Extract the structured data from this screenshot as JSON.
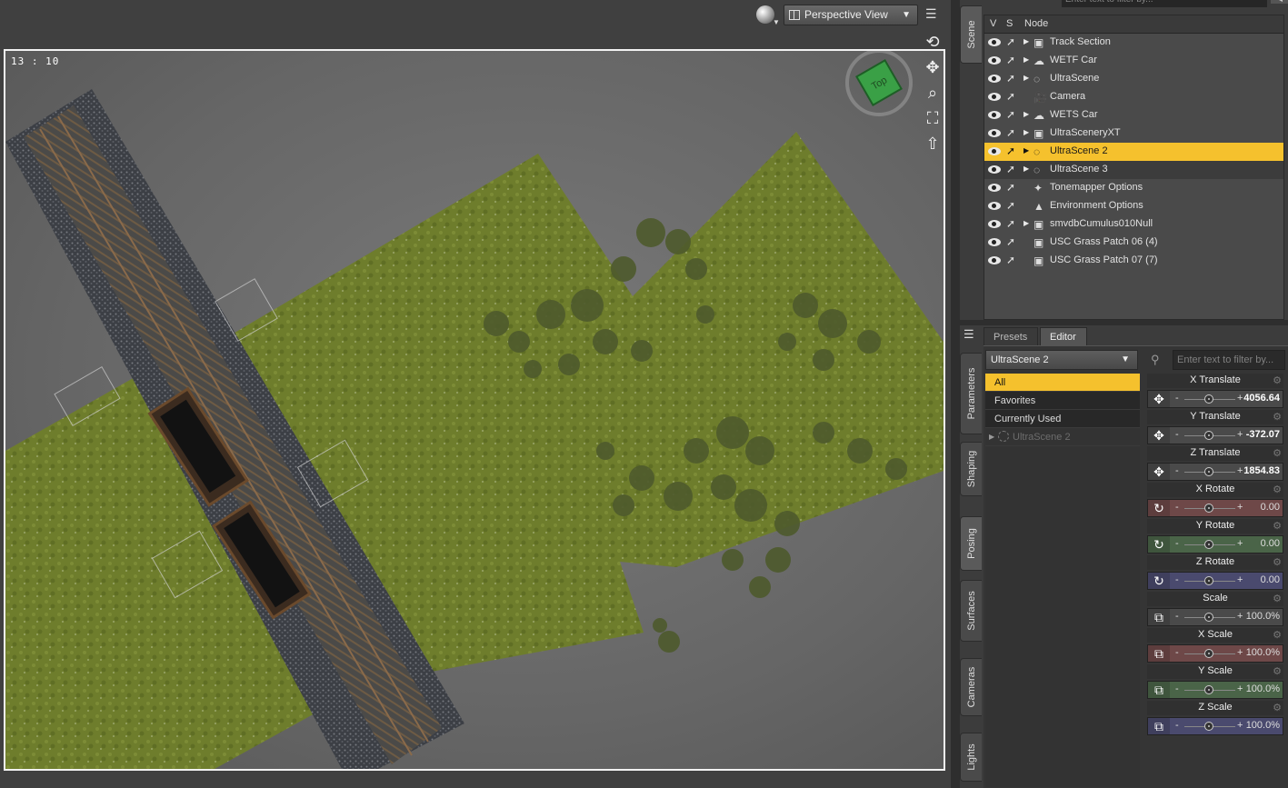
{
  "viewport": {
    "view_label": "Perspective View",
    "time": "13 : 10",
    "cube_label": "Top",
    "nav_icons": [
      "orbit-icon",
      "pan-icon",
      "zoom-icon",
      "frame-icon",
      "reset-icon"
    ]
  },
  "scene": {
    "tab_label": "Scene",
    "filter_placeholder": "Enter text to filter by...",
    "columns": {
      "v": "V",
      "s": "S",
      "node": "Node"
    },
    "nodes": [
      {
        "label": "Track Section",
        "icon": "figure-icon",
        "expandable": true,
        "state": "normal"
      },
      {
        "label": "WETF Car",
        "icon": "cloud-icon",
        "expandable": true,
        "state": "normal"
      },
      {
        "label": "UltraScene",
        "icon": "null-icon",
        "expandable": true,
        "state": "normal"
      },
      {
        "label": "Camera",
        "icon": "camera-icon",
        "expandable": false,
        "state": "normal"
      },
      {
        "label": "WETS Car",
        "icon": "cloud-icon",
        "expandable": true,
        "state": "normal"
      },
      {
        "label": "UltraSceneryXT",
        "icon": "figure-icon",
        "expandable": true,
        "state": "normal"
      },
      {
        "label": "UltraScene 2",
        "icon": "null-icon",
        "expandable": true,
        "state": "selected"
      },
      {
        "label": "UltraScene 3",
        "icon": "null-icon",
        "expandable": true,
        "state": "hover"
      },
      {
        "label": "Tonemapper Options",
        "icon": "tonemapper-icon",
        "expandable": false,
        "state": "normal"
      },
      {
        "label": "Environment Options",
        "icon": "environment-icon",
        "expandable": false,
        "state": "normal"
      },
      {
        "label": "smvdbCumulus010Null",
        "icon": "figure-icon",
        "expandable": true,
        "state": "normal"
      },
      {
        "label": "USC Grass Patch 06 (4)",
        "icon": "figure-icon",
        "expandable": false,
        "state": "normal"
      },
      {
        "label": "USC Grass Patch 07 (7)",
        "icon": "figure-icon",
        "expandable": false,
        "state": "normal"
      }
    ]
  },
  "side_tabs": [
    "Parameters",
    "Shaping",
    "Posing",
    "Surfaces",
    "Cameras",
    "Lights"
  ],
  "params": {
    "tabs": [
      "Presets",
      "Editor"
    ],
    "active_tab": "Editor",
    "node_select": "UltraScene 2",
    "filter_placeholder": "Enter text to filter by...",
    "groups": [
      "All",
      "Favorites",
      "Currently Used"
    ],
    "tree_node": "UltraScene 2",
    "sliders": [
      {
        "name": "X Translate",
        "value": "4056.64",
        "color": "grey",
        "icon": "translate-icon",
        "bold": true
      },
      {
        "name": "Y Translate",
        "value": "-372.07",
        "color": "grey",
        "icon": "translate-icon",
        "bold": true
      },
      {
        "name": "Z Translate",
        "value": "1854.83",
        "color": "grey",
        "icon": "translate-icon",
        "bold": true
      },
      {
        "name": "X Rotate",
        "value": "0.00",
        "color": "red",
        "icon": "rotate-icon",
        "bold": false
      },
      {
        "name": "Y Rotate",
        "value": "0.00",
        "color": "green",
        "icon": "rotate-icon",
        "bold": false
      },
      {
        "name": "Z Rotate",
        "value": "0.00",
        "color": "blue",
        "icon": "rotate-icon",
        "bold": false
      },
      {
        "name": "Scale",
        "value": "100.0%",
        "color": "grey",
        "icon": "scale-icon",
        "bold": false
      },
      {
        "name": "X Scale",
        "value": "100.0%",
        "color": "red",
        "icon": "scale-icon",
        "bold": false
      },
      {
        "name": "Y Scale",
        "value": "100.0%",
        "color": "green",
        "icon": "scale-icon",
        "bold": false
      },
      {
        "name": "Z Scale",
        "value": "100.0%",
        "color": "blue",
        "icon": "scale-icon",
        "bold": false
      }
    ]
  },
  "colors": {
    "selection": "#f5c12d",
    "grass": "#6f7f2a",
    "ground": "#6b6b6b",
    "cube": "#3aa046"
  }
}
